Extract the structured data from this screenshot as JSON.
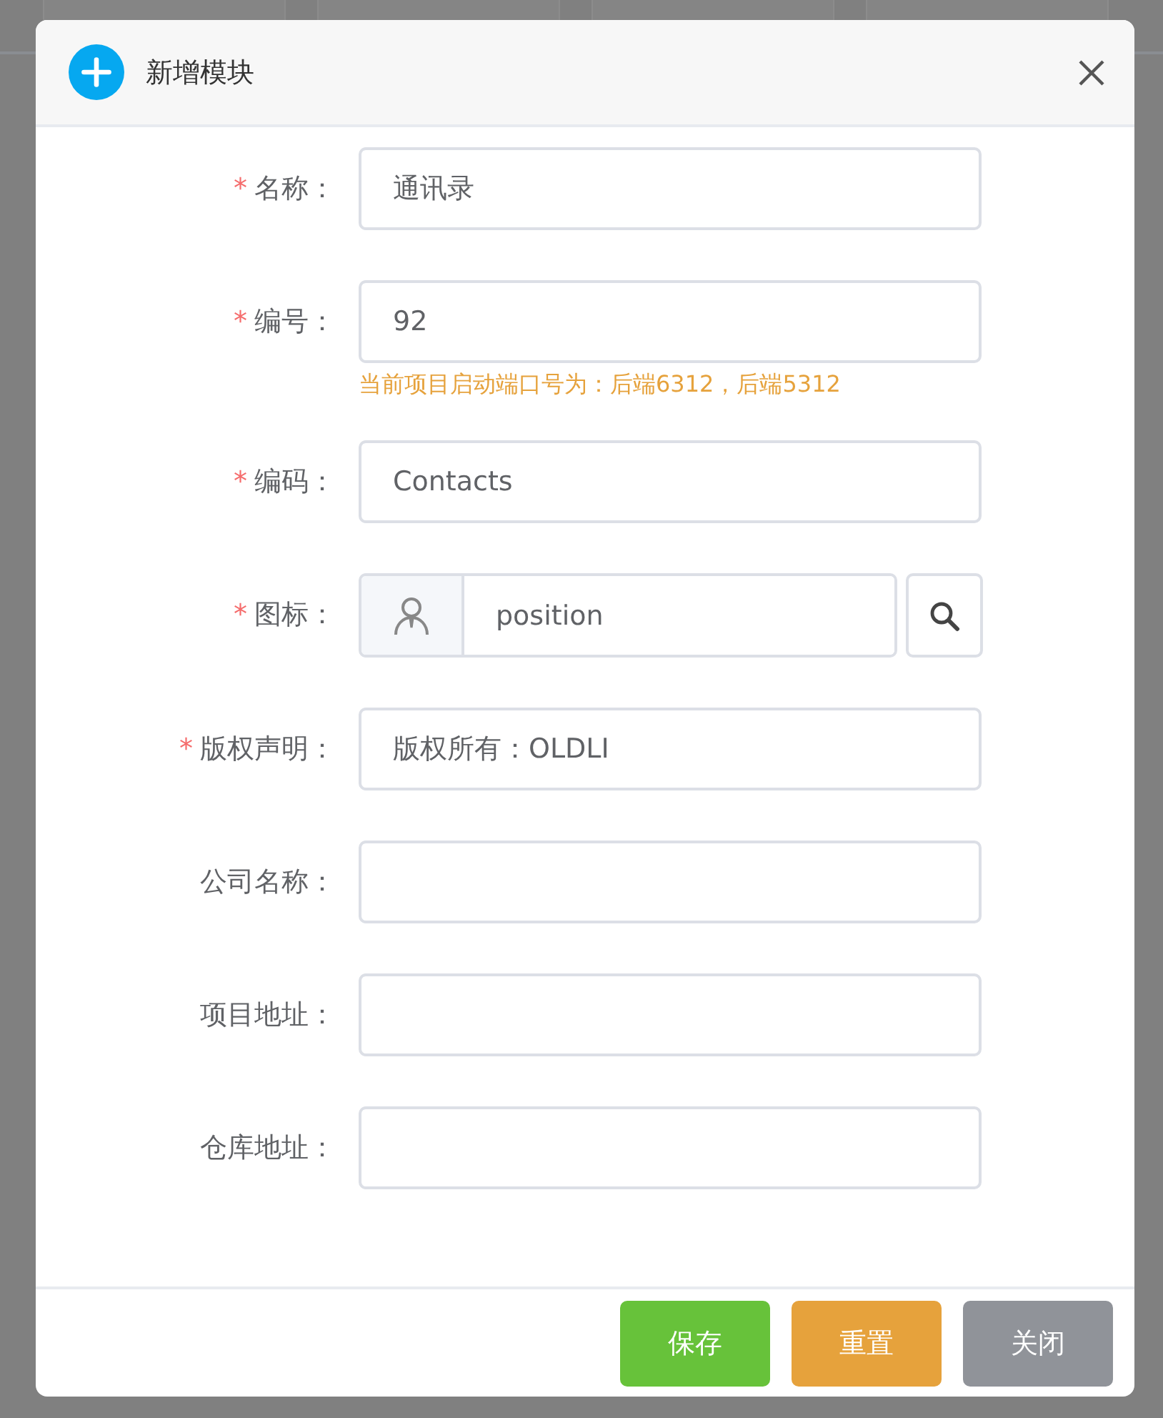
{
  "dialog": {
    "title": "新增模块"
  },
  "fields": [
    {
      "kind": "text",
      "required_mark": "*",
      "label": "名称：",
      "value": "通讯录"
    },
    {
      "kind": "text",
      "required_mark": "*",
      "label": "编号：",
      "value": "92",
      "hint": "当前项目启动端口号为：后端6312，后端5312"
    },
    {
      "kind": "text",
      "required_mark": "*",
      "label": "编码：",
      "value": "Contacts"
    },
    {
      "kind": "icon",
      "required_mark": "*",
      "label": "图标：",
      "value": "position"
    },
    {
      "kind": "text",
      "required_mark": "*",
      "label": "版权声明：",
      "value": "版权所有：OLDLI"
    },
    {
      "kind": "text",
      "label": "公司名称："
    },
    {
      "kind": "text",
      "label": "项目地址："
    },
    {
      "kind": "text",
      "label": "仓库地址："
    }
  ],
  "buttons": [
    {
      "label": "保存",
      "color": "#67c23a"
    },
    {
      "label": "重置",
      "color": "#e6a23c"
    },
    {
      "label": "关闭",
      "color": "#909399"
    }
  ]
}
